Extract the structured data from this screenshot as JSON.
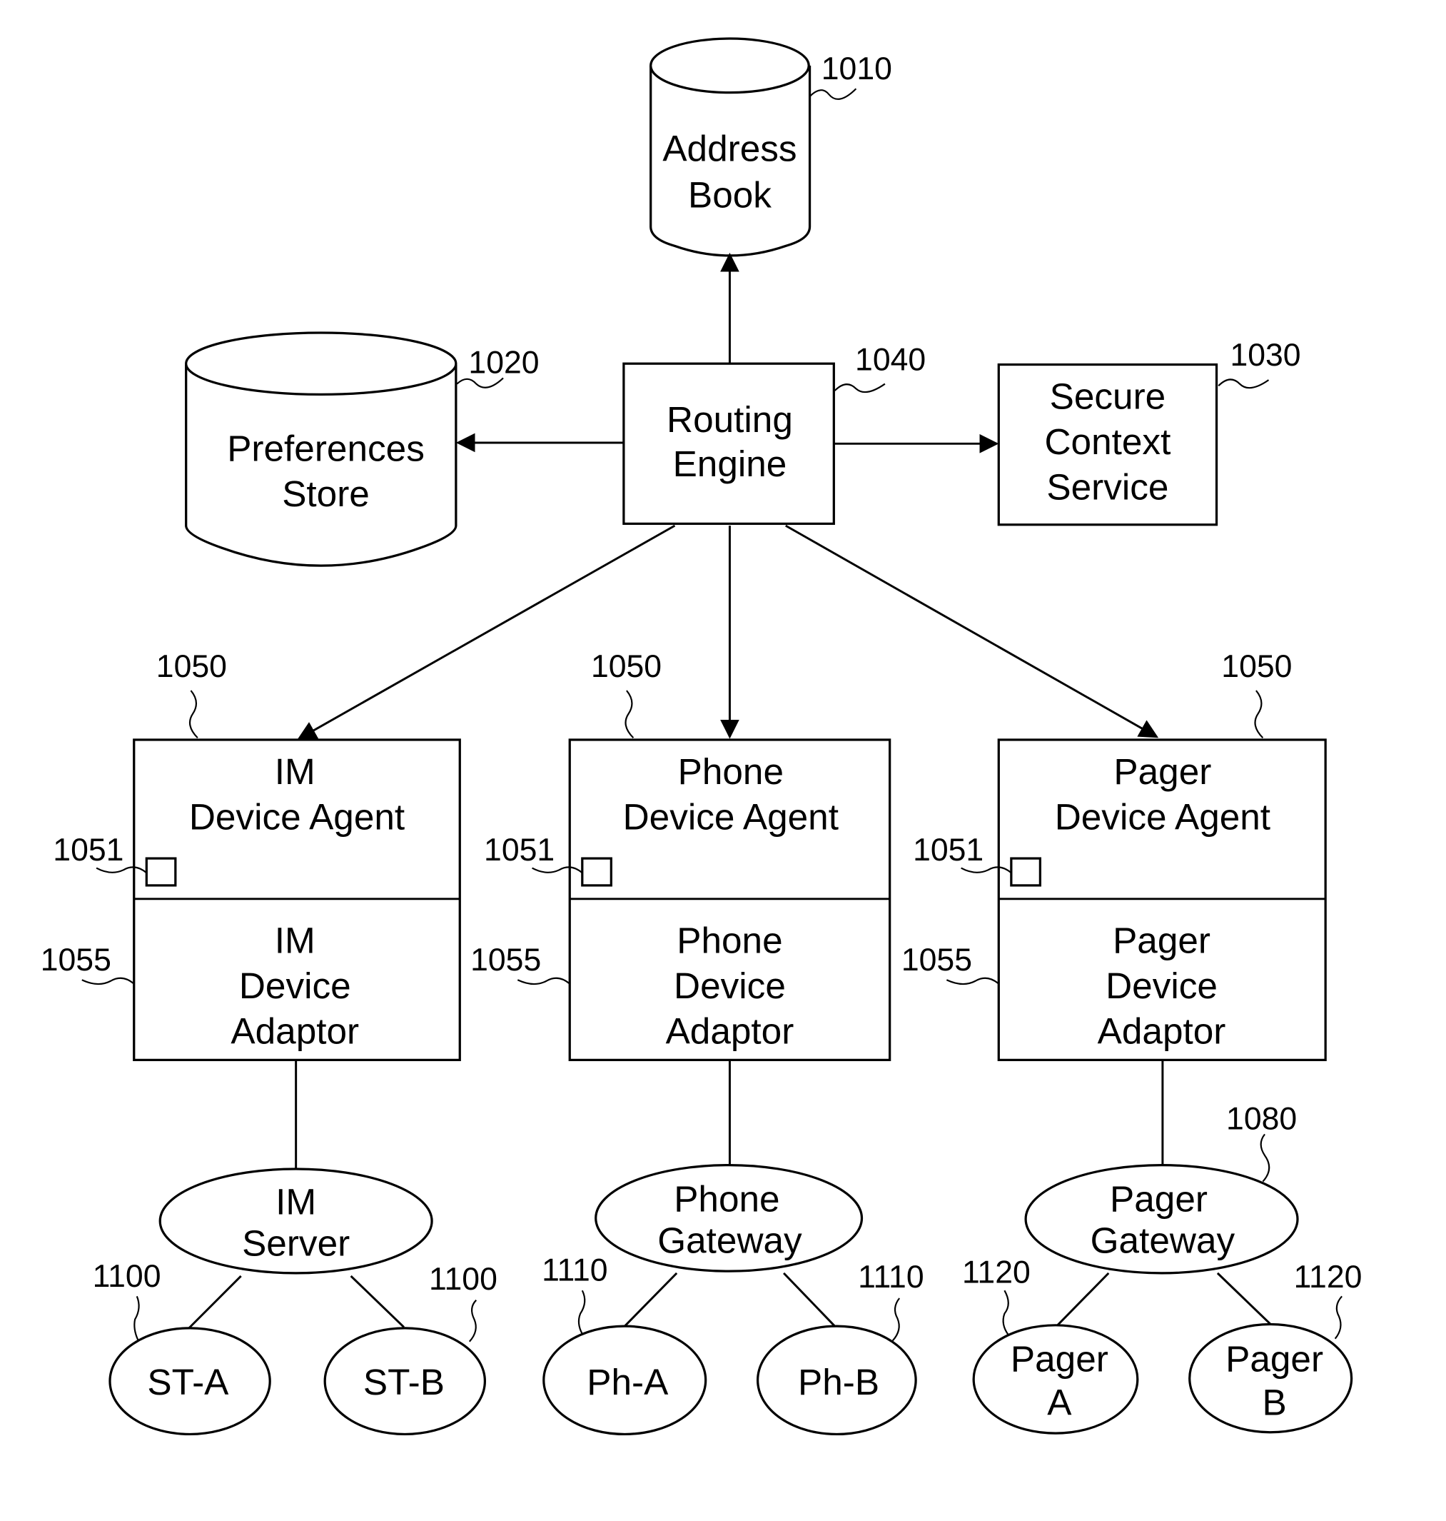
{
  "diagram": {
    "address_book": {
      "lines": [
        "Address",
        "Book"
      ],
      "ref": "1010"
    },
    "preferences_store": {
      "lines": [
        "Preferences",
        "Store"
      ],
      "ref": "1020"
    },
    "routing_engine": {
      "lines": [
        "Routing",
        "Engine"
      ],
      "ref": "1040"
    },
    "secure_context_service": {
      "lines": [
        "Secure",
        "Context",
        "Service"
      ],
      "ref": "1030"
    },
    "agents": [
      {
        "agent_lines": [
          "IM",
          "Device Agent"
        ],
        "adaptor_lines": [
          "IM",
          "Device",
          "Adaptor"
        ],
        "agent_ref": "1050",
        "slot_ref": "1051",
        "adaptor_ref": "1055"
      },
      {
        "agent_lines": [
          "Phone",
          "Device Agent"
        ],
        "adaptor_lines": [
          "Phone",
          "Device",
          "Adaptor"
        ],
        "agent_ref": "1050",
        "slot_ref": "1051",
        "adaptor_ref": "1055"
      },
      {
        "agent_lines": [
          "Pager",
          "Device Agent"
        ],
        "adaptor_lines": [
          "Pager",
          "Device",
          "Adaptor"
        ],
        "agent_ref": "1050",
        "slot_ref": "1051",
        "adaptor_ref": "1055"
      }
    ],
    "gateways": [
      {
        "lines": [
          "IM",
          "Server"
        ],
        "ref": ""
      },
      {
        "lines": [
          "Phone",
          "Gateway"
        ],
        "ref": ""
      },
      {
        "lines": [
          "Pager",
          "Gateway"
        ],
        "ref": "1080"
      }
    ],
    "devices": [
      {
        "lines": [
          "ST-A"
        ],
        "ref": "1100"
      },
      {
        "lines": [
          "ST-B"
        ],
        "ref": "1100"
      },
      {
        "lines": [
          "Ph-A"
        ],
        "ref": "1110"
      },
      {
        "lines": [
          "Ph-B"
        ],
        "ref": "1110"
      },
      {
        "lines": [
          "Pager",
          "A"
        ],
        "ref": "1120"
      },
      {
        "lines": [
          "Pager",
          "B"
        ],
        "ref": "1120"
      }
    ]
  }
}
